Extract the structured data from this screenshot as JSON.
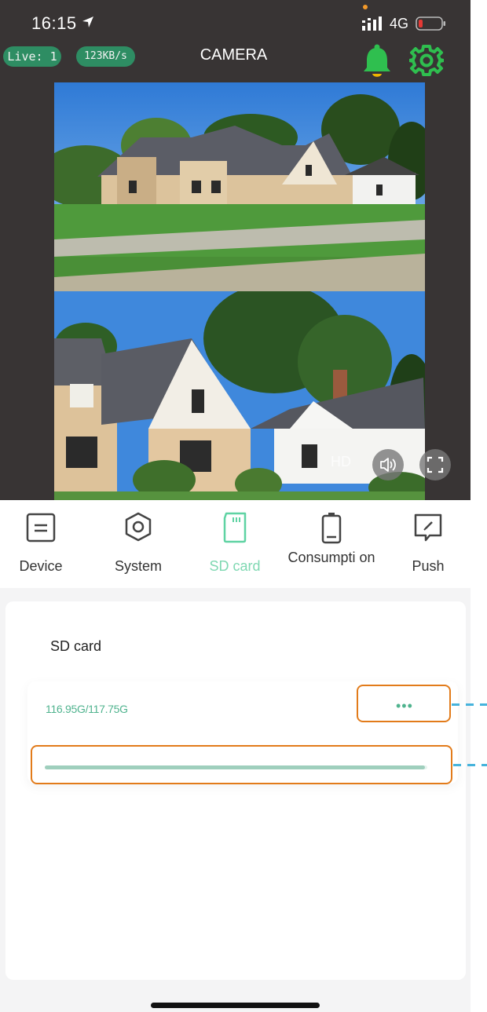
{
  "status_bar": {
    "time": "16:15",
    "network": "4G",
    "icons": [
      "location-arrow-icon",
      "signal-icon",
      "battery-low-icon"
    ]
  },
  "header": {
    "live_badge": "Live: 1",
    "speed_badge": "123KB/s",
    "title": "CAMERA",
    "icons": [
      "bell-icon",
      "gear-icon"
    ],
    "accent": "#2fbf4f"
  },
  "video_controls": {
    "quality_label": "HD",
    "icons": [
      "speaker-icon",
      "fullscreen-icon"
    ]
  },
  "tabs": [
    {
      "label": "Device",
      "icon": "device-icon"
    },
    {
      "label": "System",
      "icon": "system-icon"
    },
    {
      "label": "SD card",
      "icon": "sd-card-icon",
      "active": true
    },
    {
      "label": "Consumpti on",
      "icon": "battery-icon"
    },
    {
      "label": "Push",
      "icon": "push-icon"
    }
  ],
  "sd_card": {
    "title": "SD card",
    "capacity": "116.95G/117.75G",
    "more_label": "•••",
    "usage_fraction": 0.993
  },
  "colors": {
    "top_background": "#383434",
    "badge_green": "#2e8d63",
    "active_tab": "#7fd8b2",
    "highlight_border": "#e27b1a",
    "callout_line": "#46b3dc"
  }
}
